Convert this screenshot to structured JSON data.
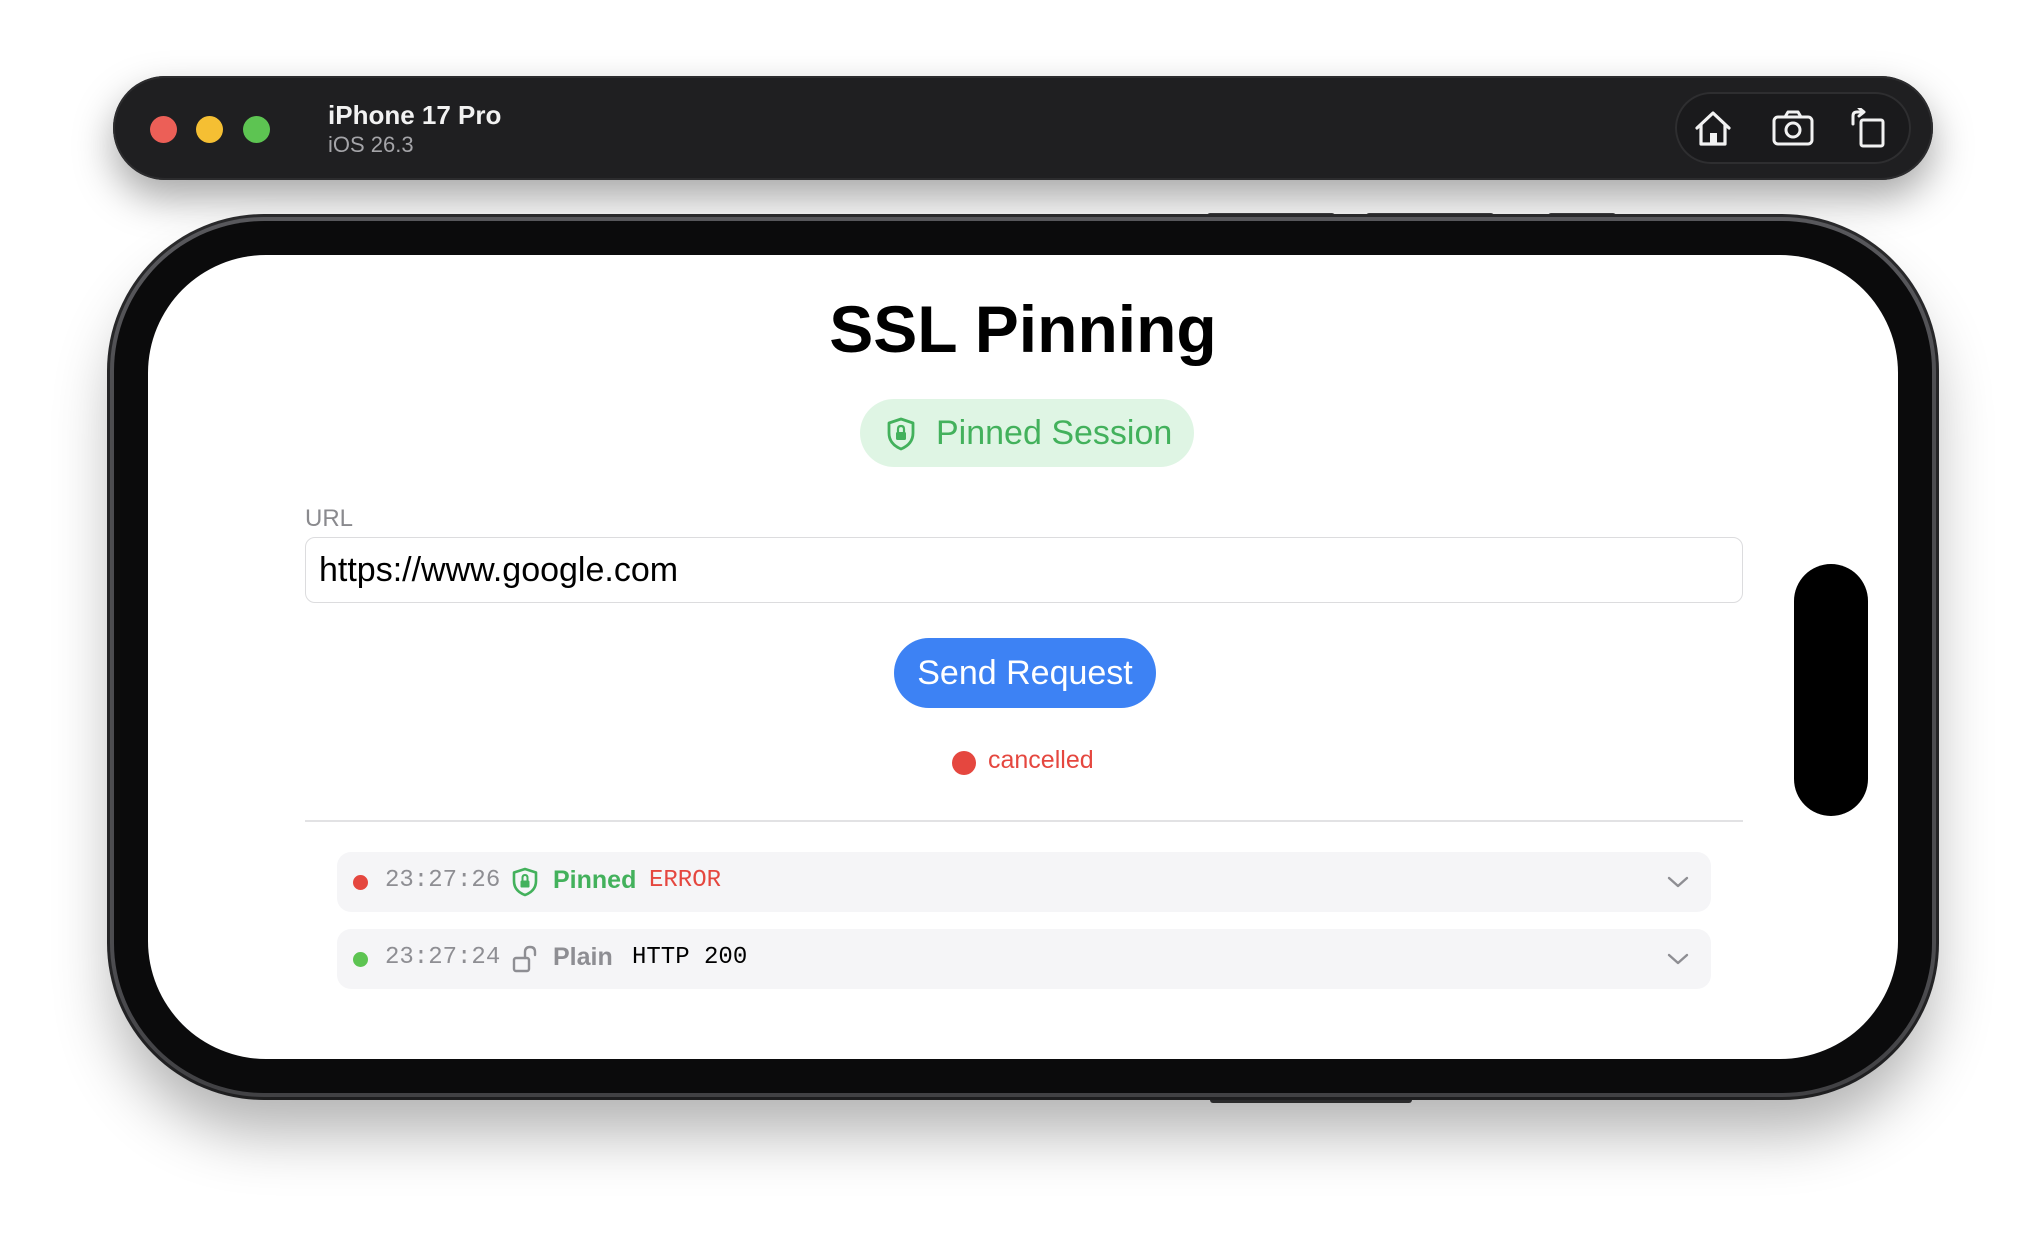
{
  "simulator": {
    "device_name": "iPhone 17 Pro",
    "os_version": "iOS 26.3",
    "toolbar": [
      "home-icon",
      "screenshot-icon",
      "rotate-icon"
    ]
  },
  "app": {
    "title": "SSL Pinning",
    "session_badge": {
      "label": "Pinned Session",
      "icon": "shield-lock-icon",
      "color": "#43b15c"
    },
    "url_field": {
      "label": "URL",
      "value": "https://www.google.com"
    },
    "send_button": {
      "label": "Send Request",
      "color": "#3d82f4"
    },
    "status": {
      "text": "cancelled",
      "color": "#e5473f"
    },
    "log": [
      {
        "time": "23:27:26",
        "status_color": "#e5473f",
        "icon": "shield-lock-icon",
        "mode": "Pinned",
        "mode_color": "#43b15c",
        "result": "ERROR",
        "result_color": "#e5473f"
      },
      {
        "time": "23:27:24",
        "status_color": "#5dc452",
        "icon": "unlock-icon",
        "mode": "Plain",
        "mode_color": "#8e8e93",
        "result": "HTTP 200",
        "result_color": "#000000"
      }
    ]
  }
}
